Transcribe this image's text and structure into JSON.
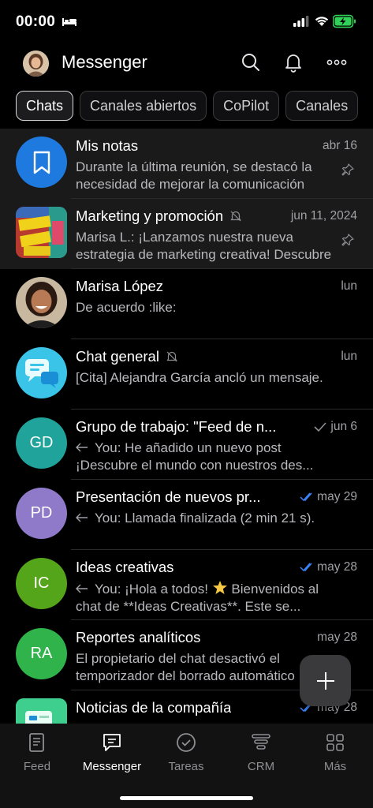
{
  "status_bar": {
    "time": "00:00"
  },
  "header": {
    "title": "Messenger"
  },
  "tabs": [
    {
      "label": "Chats"
    },
    {
      "label": "Canales abiertos"
    },
    {
      "label": "CoPilot"
    },
    {
      "label": "Canales"
    }
  ],
  "chats": [
    {
      "title": "Mis notas",
      "date": "abr 16",
      "message": "Durante la última reunión, se destacó la necesidad de mejorar la comunicación"
    },
    {
      "title": "Marketing y promoción",
      "date": "jun 11, 2024",
      "message": "Marisa L.: ¡Lanzamos nuestra nueva estrategia de marketing creativa! Descubre"
    },
    {
      "title": "Marisa López",
      "date": "lun",
      "message": "De acuerdo  :like:"
    },
    {
      "title": "Chat general",
      "date": "lun",
      "message": "[Cita]  Alejandra García ancló un mensaje."
    },
    {
      "title": "Grupo de trabajo: \"Feed de n...",
      "date": "jun 6",
      "initials": "GD",
      "message": "You: He añadido un nuevo post ¡Descubre el mundo con nuestros des..."
    },
    {
      "title": "Presentación de nuevos pr...",
      "date": "may 29",
      "initials": "PD",
      "message": "You: Llamada finalizada (2 min 21 s)."
    },
    {
      "title": "Ideas creativas",
      "date": "may 28",
      "initials": "IC",
      "message_a": "You: ¡Hola a todos! ",
      "message_b": "  Bienvenidos al chat de **Ideas Creativas**. Este se..."
    },
    {
      "title": "Reportes analíticos",
      "date": "may 28",
      "initials": "RA",
      "message": "El propietario del chat desactivó el temporizador del borrado automático"
    },
    {
      "title": "Noticias de la compañía",
      "date": "may 28",
      "message": ""
    }
  ],
  "avatar_colors": {
    "notes": "#1f7ae0",
    "GD": "#1fa39a",
    "PD": "#8f79c9",
    "IC": "#55a51a",
    "RA": "#2fb34a",
    "chat_general": "#3ac4e8",
    "news": "#3ecf8e"
  },
  "nav": [
    {
      "label": "Feed",
      "icon": "feed-icon"
    },
    {
      "label": "Messenger",
      "icon": "messenger-icon"
    },
    {
      "label": "Tareas",
      "icon": "tasks-icon"
    },
    {
      "label": "CRM",
      "icon": "crm-icon"
    },
    {
      "label": "Más",
      "icon": "more-grid-icon"
    }
  ]
}
